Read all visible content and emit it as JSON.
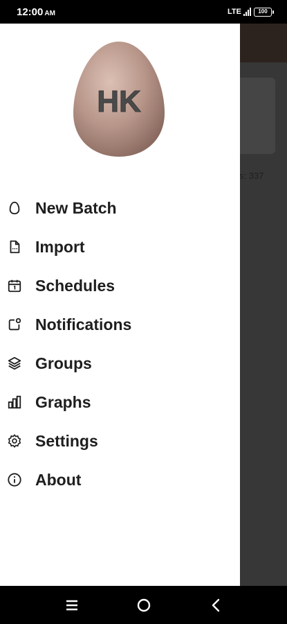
{
  "status_bar": {
    "time": "12:00",
    "ampm": "AM",
    "network": "LTE",
    "battery": "100"
  },
  "background": {
    "partial_text": "s: 337"
  },
  "drawer": {
    "logo_text": "HK",
    "items": [
      {
        "label": "New Batch",
        "icon": "egg-icon"
      },
      {
        "label": "Import",
        "icon": "file-icon"
      },
      {
        "label": "Schedules",
        "icon": "calendar-icon"
      },
      {
        "label": "Notifications",
        "icon": "notification-icon"
      },
      {
        "label": "Groups",
        "icon": "layers-icon"
      },
      {
        "label": "Graphs",
        "icon": "bar-chart-icon"
      },
      {
        "label": "Settings",
        "icon": "gear-icon"
      },
      {
        "label": "About",
        "icon": "info-icon"
      }
    ]
  },
  "nav_bar": {
    "buttons": [
      "menu-icon",
      "home-icon",
      "back-icon"
    ]
  }
}
